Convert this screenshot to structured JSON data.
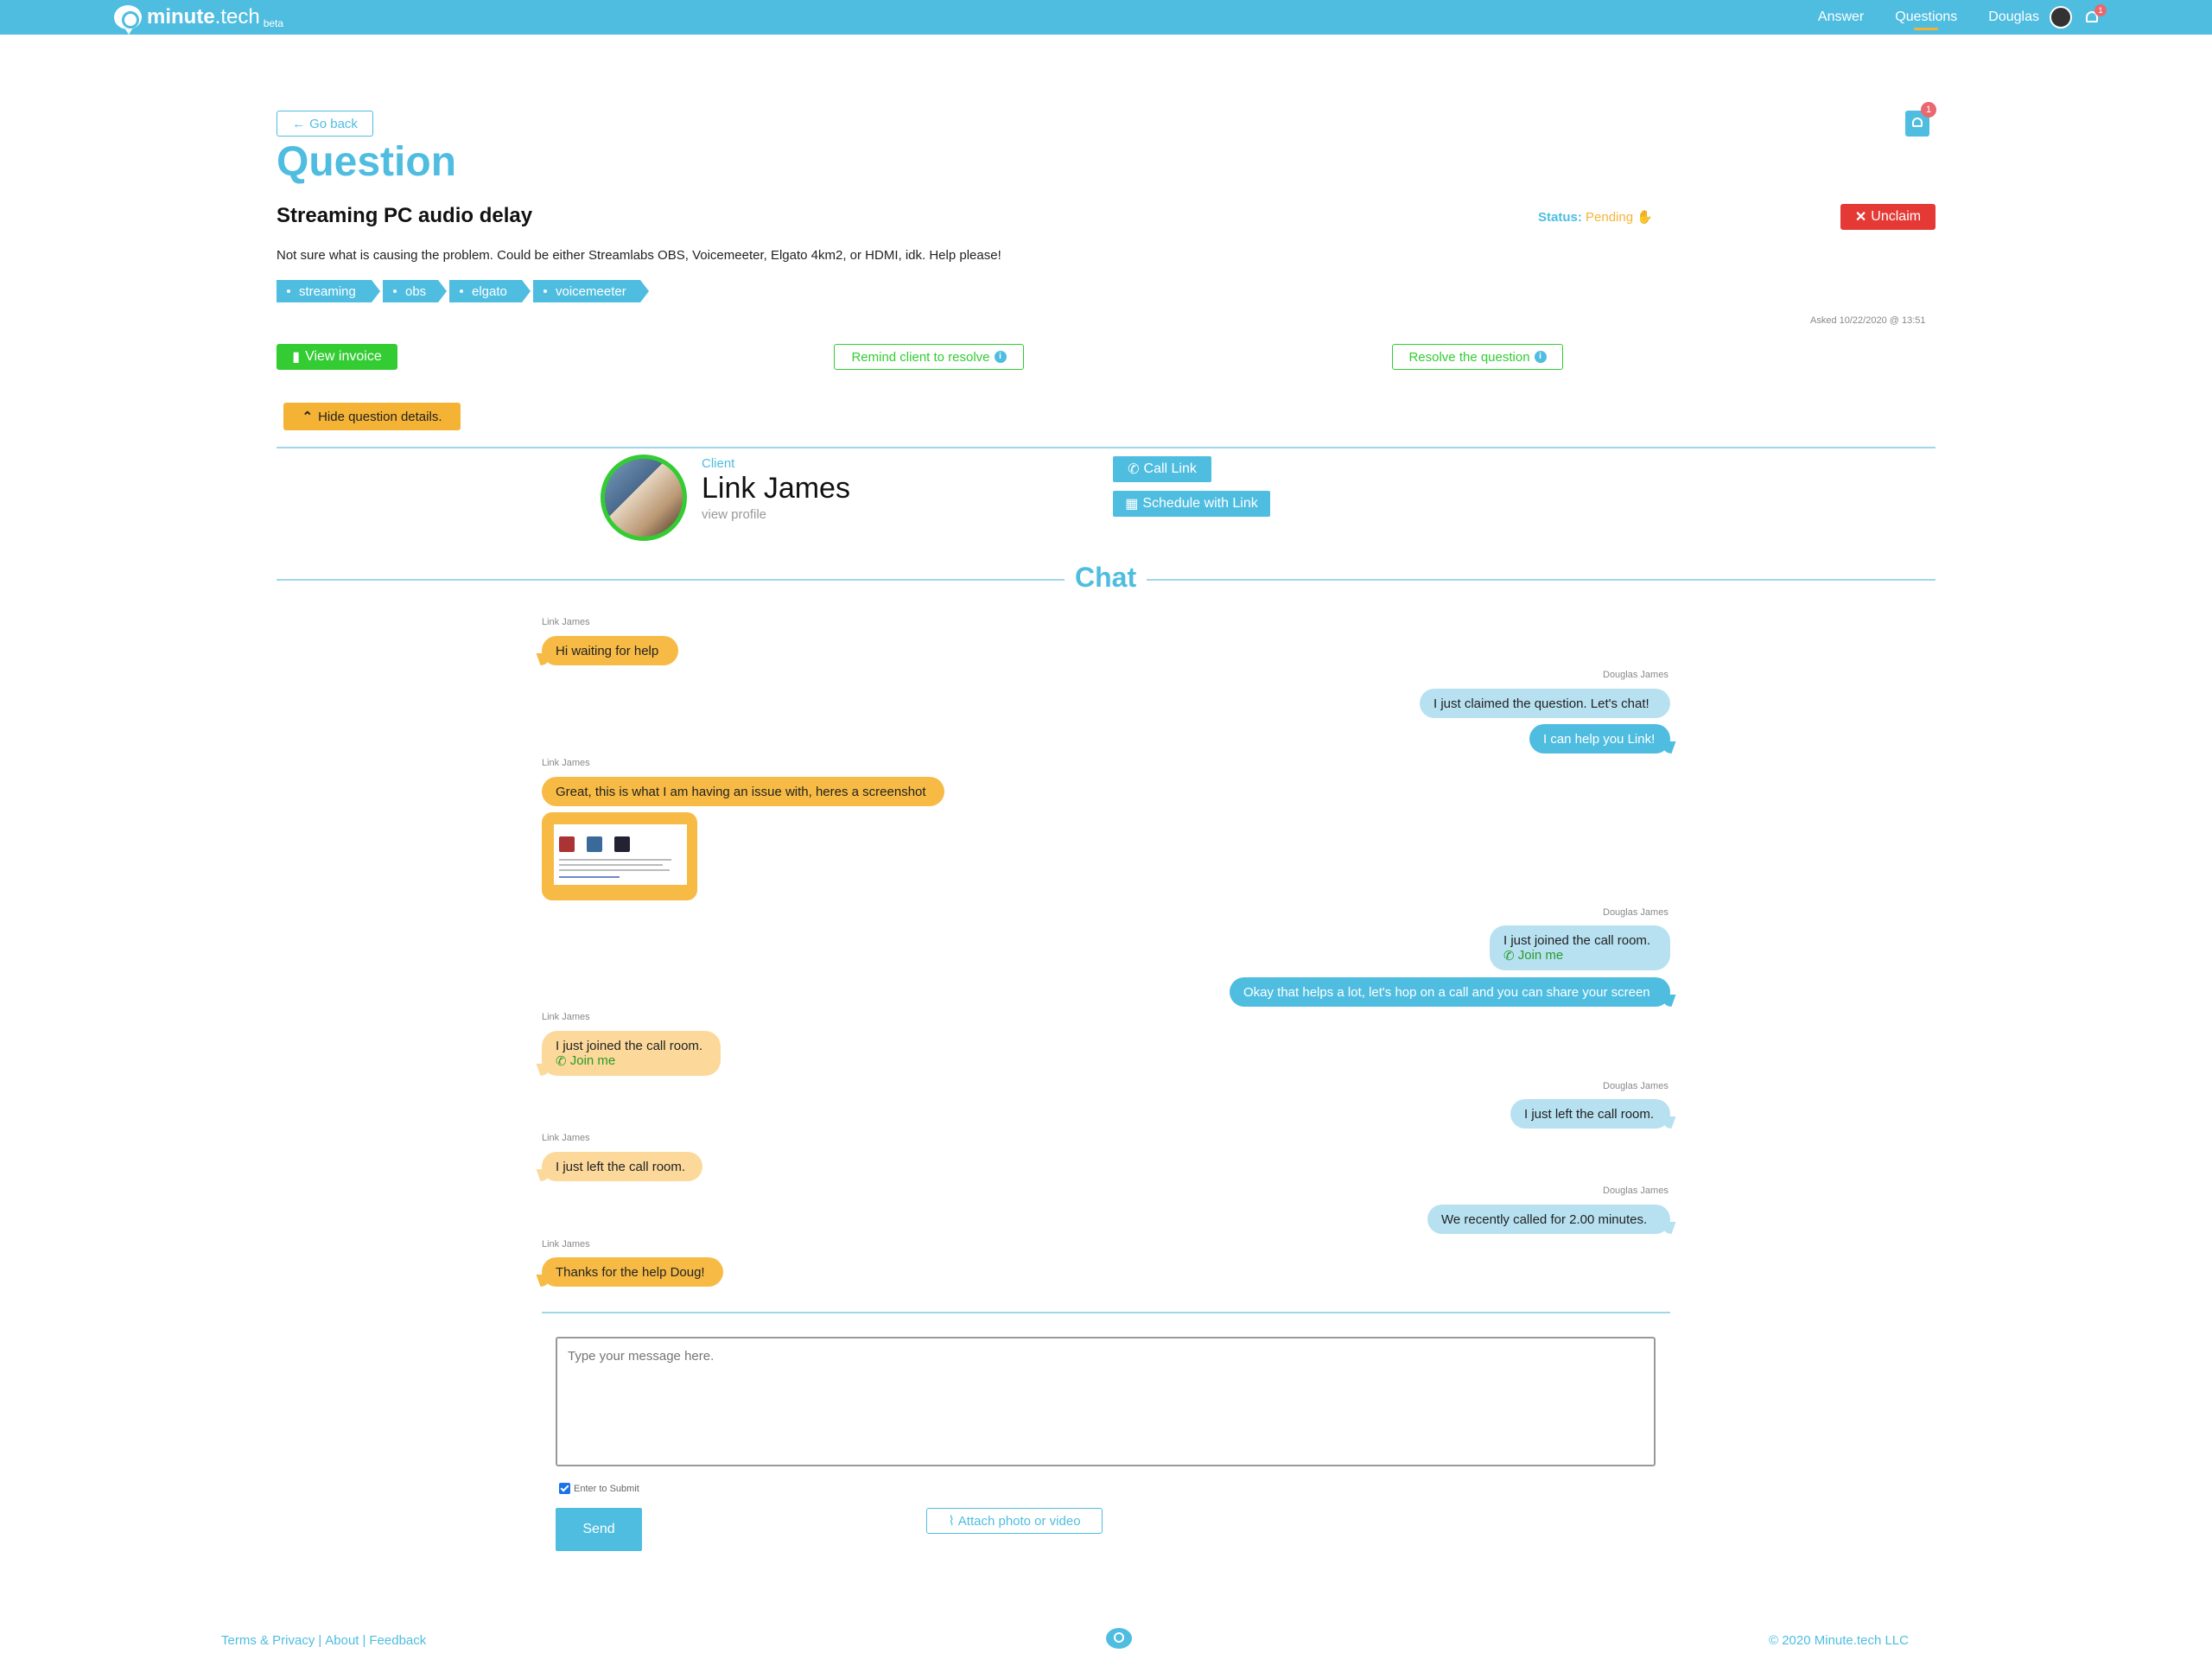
{
  "nav": {
    "brand": "minute",
    "brand_suffix": ".tech",
    "beta": "beta",
    "links": [
      "Answer",
      "Questions",
      "Douglas"
    ],
    "notifications": "1"
  },
  "page": {
    "go_back": "Go back",
    "title": "Question",
    "notif_badge": "1"
  },
  "question": {
    "title": "Streaming PC audio delay",
    "description": "Not sure what is causing the problem. Could be either Streamlabs OBS, Voicemeeter, Elgato 4km2, or HDMI, idk. Help please!",
    "tags": [
      "streaming",
      "obs",
      "elgato",
      "voicemeeter"
    ],
    "status_label": "Status:",
    "status_value": "Pending",
    "unclaim": "Unclaim",
    "asked": "Asked 10/22/2020 @ 13:51"
  },
  "actions": {
    "view_invoice": "View invoice",
    "remind": "Remind client to resolve",
    "resolve": "Resolve the question",
    "hide_details": "Hide question details."
  },
  "client": {
    "label": "Client",
    "name": "Link James",
    "view_profile": "view profile",
    "call": "Call Link",
    "schedule": "Schedule with Link"
  },
  "chat": {
    "title": "Chat",
    "messages": [
      {
        "sender": "Link James",
        "text": "Hi waiting for help"
      },
      {
        "sender": "Douglas James",
        "text": "I just claimed the question. Let's chat!"
      },
      {
        "text": "I can help you Link!"
      },
      {
        "sender": "Link James",
        "text": "Great, this is what I am having an issue with, heres a screenshot"
      },
      {
        "sender": "Douglas James",
        "text": "I just joined the call room.",
        "link": "Join me"
      },
      {
        "text": "Okay that helps a lot, let's hop on a call and you can share your screen"
      },
      {
        "sender": "Link James",
        "text": "I just joined the call room.",
        "link": "Join me"
      },
      {
        "sender": "Douglas James",
        "text": "I just left the call room."
      },
      {
        "sender": "Link James",
        "text": "I just left the call room."
      },
      {
        "sender": "Douglas James",
        "text": "We recently called for 2.00 minutes."
      },
      {
        "sender": "Link James",
        "text": "Thanks for the help Doug!"
      }
    ],
    "input_placeholder": "Type your message here.",
    "enter_to_submit": "Enter to Submit",
    "send": "Send",
    "attach": "Attach photo or video"
  },
  "footer": {
    "terms": "Terms & Privacy",
    "about": "About",
    "feedback": "Feedback",
    "copyright": "© 2020 Minute.tech LLC"
  }
}
